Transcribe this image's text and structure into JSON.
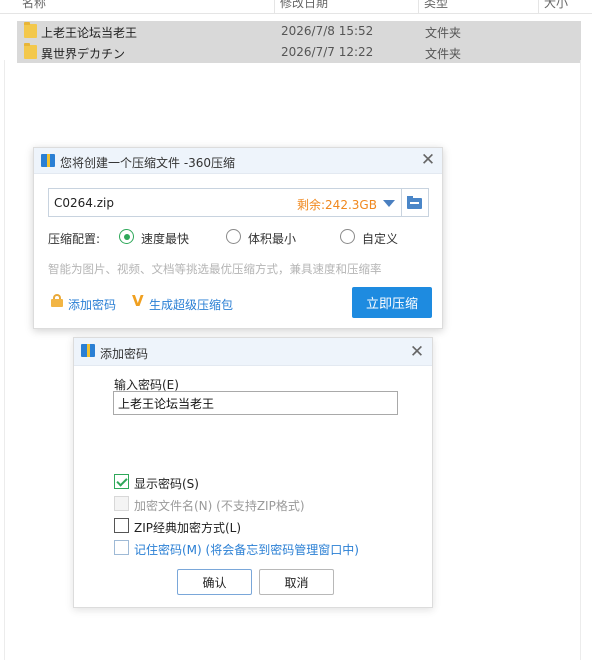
{
  "explorer": {
    "headers": {
      "name": "名称",
      "modified": "修改日期",
      "type": "类型",
      "size": "大小"
    },
    "files": [
      {
        "name": "上老王论坛当老王",
        "modified": "2026/7/8 15:52",
        "type": "文件夹"
      },
      {
        "name": "異世界デカチン",
        "modified": "2026/7/7 12:22",
        "type": "文件夹"
      }
    ]
  },
  "compress_dialog": {
    "title": "您将创建一个压缩文件 -360压缩",
    "filename": "C0264.zip",
    "free_space": "剩余:242.3GB",
    "config_label": "压缩配置:",
    "options": [
      "速度最快",
      "体积最小",
      "自定义"
    ],
    "selected_option": "速度最快",
    "hint": "智能为图片、视频、文档等挑选最优压缩方式，兼具速度和压缩率",
    "add_password": "添加密码",
    "super_package": "生成超级压缩包",
    "compress_now": "立即压缩",
    "icons": {
      "app": "360zip-icon",
      "close": "close-icon",
      "dropdown": "chevron-down-icon",
      "browse": "folder-icon",
      "lock": "lock-icon",
      "super": "v-icon"
    },
    "accent_color": "#1e8be0",
    "free_color": "#f0881e"
  },
  "password_dialog": {
    "title": "添加密码",
    "input_label": "输入密码(E)",
    "password_value": "上老王论坛当老王",
    "checkboxes": [
      {
        "label": "显示密码(S)",
        "checked": true,
        "enabled": true
      },
      {
        "label": "加密文件名(N) (不支持ZIP格式)",
        "checked": false,
        "enabled": false
      },
      {
        "label": "ZIP经典加密方式(L)",
        "checked": false,
        "enabled": true
      },
      {
        "label": "记住密码(M) (将会备忘到密码管理窗口中)",
        "checked": false,
        "enabled": true
      }
    ],
    "ok_label": "确认",
    "cancel_label": "取消"
  }
}
